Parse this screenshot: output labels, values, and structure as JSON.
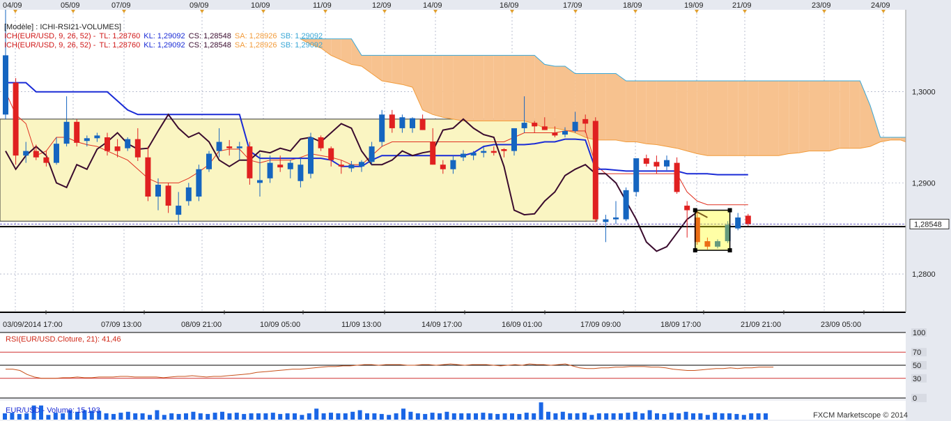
{
  "top_dates": [
    "04/09",
    "05/09",
    "07/09",
    "09/09",
    "10/09",
    "11/09",
    "12/09",
    "14/09",
    "16/09",
    "17/09",
    "18/09",
    "19/09",
    "21/09",
    "23/09",
    "24/09"
  ],
  "bottom_dates": [
    "03/09/2014 17:00",
    "07/09 13:00",
    "08/09 21:00",
    "10/09 05:00",
    "11/09 13:00",
    "14/09 17:00",
    "16/09 01:00",
    "17/09 09:00",
    "18/09 17:00",
    "21/09 21:00",
    "23/09 05:00"
  ],
  "price_axis": {
    "labels": [
      "1,3000",
      "1,2900",
      "1,2800"
    ],
    "values": [
      1.3,
      1.29,
      1.28
    ],
    "current": "1,28548",
    "current_value": 1.28548
  },
  "legend": {
    "line1": {
      "prefix": "[Modèle] : ICHI-RSI21-VOLUMES]"
    },
    "line2": {
      "name": "ICH(EUR/USD, 9, 26, 52) - ",
      "tl": "TL: 1,28760",
      "kl": "KL: 1,29092",
      "cs": "CS: 1,28548",
      "sa": "SA: 1,28926",
      "sb": "SB: 1,29092"
    },
    "line3": {
      "name": "ICH(EUR/USD, 9, 26, 52) - ",
      "tl": "TL: 1,28760",
      "kl": "KL: 1,29092",
      "cs": "CS: 1,28548",
      "sa": "SA: 1,28926",
      "sb": "SB: 1,29092"
    }
  },
  "rsi_panel": {
    "caption": "RSI(EUR/USD.Cloture, 21): 41,46",
    "levels": [
      "100",
      "70",
      "50",
      "30",
      "0"
    ],
    "level_values": [
      100,
      70,
      50,
      30,
      0
    ],
    "current_value": 41.46
  },
  "volume_panel": {
    "caption": "EUR/USD - Volume: 15 193"
  },
  "watermark": "FXCM Marketscope © 2014",
  "colors": {
    "bull": "#1565c0",
    "bear": "#e02020",
    "tenkan": "#e03020",
    "kijun": "#1a2bd6",
    "chikou": "#3a0b2e",
    "cloud_orange": "#f7c28f",
    "cloud_blue": "#a9d4ef",
    "zone": "#faf5c2",
    "grid": "#8a94b0"
  },
  "chart_data": [
    {
      "type": "candlestick",
      "title": "EUR/USD",
      "ylim": [
        1.2758,
        1.309
      ],
      "candles": [
        [
          1.2975,
          1.309,
          1.297,
          1.304
        ],
        [
          1.301,
          1.3015,
          1.292,
          1.293
        ],
        [
          1.293,
          1.2945,
          1.2922,
          1.2935
        ],
        [
          1.2935,
          1.2942,
          1.2925,
          1.2928
        ],
        [
          1.2928,
          1.2935,
          1.2918,
          1.2922
        ],
        [
          1.2922,
          1.295,
          1.292,
          1.2943
        ],
        [
          1.2943,
          1.2995,
          1.294,
          1.2967
        ],
        [
          1.2967,
          1.297,
          1.294,
          1.2944
        ],
        [
          1.2946,
          1.2952,
          1.294,
          1.2949
        ],
        [
          1.2949,
          1.2955,
          1.2945,
          1.2952
        ],
        [
          1.295,
          1.2955,
          1.293,
          1.2935
        ],
        [
          1.294,
          1.2948,
          1.2928,
          1.2935
        ],
        [
          1.2938,
          1.295,
          1.2935,
          1.2948
        ],
        [
          1.2948,
          1.296,
          1.2924,
          1.2928
        ],
        [
          1.2928,
          1.294,
          1.288,
          1.2885
        ],
        [
          1.2885,
          1.2905,
          1.287,
          1.2898
        ],
        [
          1.2897,
          1.29,
          1.2867,
          1.2875
        ],
        [
          1.2865,
          1.289,
          1.2855,
          1.2875
        ],
        [
          1.288,
          1.29,
          1.2875,
          1.2895
        ],
        [
          1.2885,
          1.292,
          1.288,
          1.2915
        ],
        [
          1.2915,
          1.2935,
          1.2912,
          1.2932
        ],
        [
          1.2935,
          1.296,
          1.2928,
          1.2945
        ],
        [
          1.294,
          1.2947,
          1.293,
          1.2938
        ],
        [
          1.2938,
          1.2945,
          1.2925,
          1.294
        ],
        [
          1.294,
          1.2945,
          1.2898,
          1.2905
        ],
        [
          1.29,
          1.2932,
          1.2885,
          1.2903
        ],
        [
          1.2905,
          1.293,
          1.29,
          1.2922
        ],
        [
          1.292,
          1.293,
          1.2912,
          1.2917
        ],
        [
          1.2915,
          1.2925,
          1.2905,
          1.2922
        ],
        [
          1.2902,
          1.2928,
          1.2895,
          1.292
        ],
        [
          1.291,
          1.2955,
          1.2905,
          1.295
        ],
        [
          1.295,
          1.2952,
          1.2935,
          1.2938
        ],
        [
          1.2938,
          1.294,
          1.2918,
          1.2925
        ],
        [
          1.292,
          1.2925,
          1.291,
          1.2918
        ],
        [
          1.2916,
          1.2924,
          1.2912,
          1.292
        ],
        [
          1.2918,
          1.2925,
          1.2912,
          1.2923
        ],
        [
          1.2923,
          1.2945,
          1.292,
          1.294
        ],
        [
          1.2945,
          1.298,
          1.294,
          1.2975
        ],
        [
          1.2975,
          1.298,
          1.2955,
          1.296
        ],
        [
          1.296,
          1.2975,
          1.2955,
          1.2972
        ],
        [
          1.296,
          1.2972,
          1.2955,
          1.2971
        ],
        [
          1.297,
          1.2975,
          1.2958,
          1.2958
        ],
        [
          1.2945,
          1.296,
          1.292,
          1.292
        ],
        [
          1.292,
          1.2925,
          1.291,
          1.2915
        ],
        [
          1.2915,
          1.293,
          1.291,
          1.2925
        ],
        [
          1.2928,
          1.2936,
          1.2924,
          1.2932
        ],
        [
          1.293,
          1.2935,
          1.2925,
          1.2933
        ],
        [
          1.2933,
          1.294,
          1.2928,
          1.2935
        ],
        [
          1.2935,
          1.294,
          1.293,
          1.2933
        ],
        [
          1.2937,
          1.2938,
          1.2928,
          1.2935
        ],
        [
          1.2935,
          1.296,
          1.293,
          1.296
        ],
        [
          1.296,
          1.2995,
          1.2955,
          1.2966
        ],
        [
          1.2966,
          1.2968,
          1.2955,
          1.2962
        ],
        [
          1.2962,
          1.2972,
          1.2958,
          1.2958
        ],
        [
          1.2955,
          1.2962,
          1.295,
          1.2952
        ],
        [
          1.2953,
          1.2961,
          1.295,
          1.2957
        ],
        [
          1.2957,
          1.2978,
          1.2955,
          1.2967
        ],
        [
          1.297,
          1.2975,
          1.2955,
          1.2965
        ],
        [
          1.2968,
          1.2972,
          1.2857,
          1.286
        ],
        [
          1.2857,
          1.2865,
          1.2835,
          1.286
        ],
        [
          1.286,
          1.288,
          1.2855,
          1.2862
        ],
        [
          1.286,
          1.2895,
          1.2858,
          1.2892
        ],
        [
          1.289,
          1.292,
          1.2885,
          1.2927
        ],
        [
          1.2927,
          1.2931,
          1.2918,
          1.2921
        ],
        [
          1.2923,
          1.293,
          1.291,
          1.2918
        ],
        [
          1.2918,
          1.293,
          1.2914,
          1.2925
        ],
        [
          1.2922,
          1.2928,
          1.2888,
          1.289
        ],
        [
          1.2875,
          1.288,
          1.284,
          1.287
        ],
        [
          1.2862,
          1.2868,
          1.2832,
          1.2835
        ],
        [
          1.2836,
          1.284,
          1.2827,
          1.283
        ],
        [
          1.283,
          1.2838,
          1.2828,
          1.2836
        ],
        [
          1.2836,
          1.2858,
          1.2834,
          1.2854
        ],
        [
          1.285,
          1.2867,
          1.2848,
          1.2862
        ],
        [
          1.2864,
          1.2866,
          1.2853,
          1.2855
        ]
      ],
      "tenkan": [
        1.3,
        1.2975,
        1.2965,
        1.293,
        1.2935,
        1.295,
        1.295,
        1.2945,
        1.2942,
        1.294,
        1.2935,
        1.293,
        1.2925,
        1.2915,
        1.2905,
        1.29,
        1.29,
        1.29,
        1.2905,
        1.2912,
        1.292,
        1.2935,
        1.2937,
        1.2937,
        1.2925,
        1.2922,
        1.2925,
        1.2925,
        1.2925,
        1.2928,
        1.2932,
        1.293,
        1.2928,
        1.2925,
        1.292,
        1.292,
        1.293,
        1.294,
        1.2945,
        1.2945,
        1.2945,
        1.2945,
        1.2945,
        1.2945,
        1.2945,
        1.2945,
        1.2945,
        1.2945,
        1.2945,
        1.2945,
        1.295,
        1.2955,
        1.2955,
        1.2955,
        1.2955,
        1.2957,
        1.2957,
        1.2957,
        1.292,
        1.291,
        1.291,
        1.291,
        1.291,
        1.291,
        1.291,
        1.291,
        1.291,
        1.289,
        1.288,
        1.2876,
        1.2876,
        1.2876,
        1.2876,
        1.2876
      ],
      "kijun": [
        1.301,
        1.301,
        1.301,
        1.3,
        1.3,
        1.3,
        1.3,
        1.3,
        1.3,
        1.3,
        1.3,
        1.299,
        1.298,
        1.2975,
        1.2975,
        1.2975,
        1.2975,
        1.2975,
        1.2975,
        1.2975,
        1.2975,
        1.2975,
        1.2975,
        1.2975,
        1.2935,
        1.2927,
        1.2927,
        1.2927,
        1.2927,
        1.2927,
        1.2927,
        1.2927,
        1.2925,
        1.2918,
        1.2918,
        1.2918,
        1.2925,
        1.293,
        1.293,
        1.293,
        1.293,
        1.293,
        1.293,
        1.293,
        1.293,
        1.293,
        1.2933,
        1.294,
        1.2942,
        1.2942,
        1.2942,
        1.2942,
        1.2943,
        1.2945,
        1.2945,
        1.2948,
        1.2948,
        1.2947,
        1.2915,
        1.2915,
        1.2914,
        1.2913,
        1.2913,
        1.2913,
        1.2913,
        1.2913,
        1.2913,
        1.291,
        1.291,
        1.291,
        1.2909,
        1.2909,
        1.2909,
        1.2909
      ],
      "chikou": [
        1.2935,
        1.2915,
        1.293,
        1.294,
        1.293,
        1.29,
        1.2895,
        1.292,
        1.2915,
        1.2937,
        1.2945,
        1.2955,
        1.2943,
        1.2937,
        1.2938,
        1.2957,
        1.2975,
        1.296,
        1.295,
        1.2955,
        1.2945,
        1.2925,
        1.2918,
        1.2925,
        1.2925,
        1.2935,
        1.2933,
        1.2938,
        1.2935,
        1.2948,
        1.295,
        1.2945,
        1.2955,
        1.2965,
        1.296,
        1.2935,
        1.292,
        1.292,
        1.2925,
        1.2935,
        1.293,
        1.2933,
        1.2935,
        1.2958,
        1.296,
        1.297,
        1.296,
        1.2953,
        1.295,
        1.2918,
        1.287,
        1.2865,
        1.2866,
        1.288,
        1.289,
        1.2908,
        1.2915,
        1.292,
        1.291,
        1.291,
        1.29,
        1.288,
        1.286,
        1.2835,
        1.2825,
        1.283,
        1.2845,
        1.286,
        1.2868,
        1.2862
      ],
      "senkou_a": [
        1.3058,
        1.3052,
        1.3048,
        1.304,
        1.3035,
        1.303,
        1.3028,
        1.302,
        1.3012,
        1.301,
        1.3008,
        1.3005,
        1.298,
        1.2975,
        1.2972,
        1.297,
        1.2968,
        1.2968,
        1.2968,
        1.2968,
        1.2968,
        1.2968,
        1.2968,
        1.2965,
        1.296,
        1.296,
        1.2958,
        1.2955,
        1.295,
        1.2947,
        1.2947,
        1.2947,
        1.2945,
        1.2945,
        1.2943,
        1.2942,
        1.294,
        1.2938,
        1.2935,
        1.2932,
        1.293,
        1.293,
        1.293,
        1.293,
        1.293,
        1.293,
        1.293,
        1.293,
        1.2932,
        1.2933,
        1.2935,
        1.2935,
        1.2935,
        1.2938,
        1.2938,
        1.2938,
        1.294,
        1.2945,
        1.2947,
        1.2947,
        1.2943,
        1.2937,
        1.2922,
        1.2916,
        1.2912,
        1.291,
        1.291
      ],
      "senkou_b": [
        1.3058,
        1.3058,
        1.3058,
        1.3058,
        1.3058,
        1.3058,
        1.304,
        1.304,
        1.304,
        1.304,
        1.304,
        1.304,
        1.304,
        1.304,
        1.304,
        1.304,
        1.304,
        1.304,
        1.304,
        1.304,
        1.304,
        1.304,
        1.304,
        1.304,
        1.303,
        1.3028,
        1.3028,
        1.302,
        1.302,
        1.302,
        1.302,
        1.302,
        1.3012,
        1.3012,
        1.3012,
        1.3012,
        1.3012,
        1.3012,
        1.3012,
        1.3012,
        1.3012,
        1.3012,
        1.3012,
        1.3012,
        1.3012,
        1.3012,
        1.3012,
        1.3012,
        1.3012,
        1.3012,
        1.3012,
        1.3012,
        1.3012,
        1.3012,
        1.3012,
        1.3012,
        1.2985,
        1.295,
        1.295,
        1.295,
        1.295,
        1.295,
        1.295,
        1.295,
        1.295,
        1.295,
        1.295,
        1.295,
        1.295,
        1.292,
        1.2913,
        1.2913,
        1.2913,
        1.291
      ],
      "zone": {
        "top": 1.297,
        "bottom": 1.2858,
        "x_end_index": 58
      },
      "hlines": [
        1.2852,
        1.2758
      ]
    },
    {
      "type": "line",
      "title": "RSI(EUR/USD.Cloture, 21)",
      "ylim": [
        0,
        100
      ],
      "levels": [
        100,
        70,
        50,
        30,
        0
      ],
      "values": [
        44,
        44,
        42,
        36,
        32,
        30,
        30,
        30,
        31,
        31,
        32,
        31,
        31,
        32,
        32,
        32,
        33,
        33,
        32,
        32,
        32,
        32,
        31,
        32,
        33,
        33,
        34,
        33,
        32,
        33,
        33,
        34,
        35,
        36,
        37,
        39,
        40,
        41,
        42,
        43,
        44,
        44,
        45,
        46,
        47,
        48,
        48,
        49,
        49,
        50,
        51,
        51,
        50,
        51,
        51,
        51,
        50,
        50,
        51,
        51,
        50,
        51,
        52,
        51,
        50,
        51,
        51,
        51,
        50,
        49,
        50,
        51,
        50,
        52,
        51,
        51,
        50,
        51,
        52,
        49,
        46,
        45,
        45,
        46,
        46,
        47,
        47,
        48,
        48,
        48,
        47,
        47,
        46,
        44,
        43,
        42,
        42,
        43,
        44,
        45,
        45,
        46,
        45,
        46,
        46,
        47,
        47,
        47
      ]
    },
    {
      "type": "bar",
      "title": "EUR/USD - Volume",
      "values": [
        20,
        22,
        18,
        20,
        45,
        45,
        15,
        22,
        20,
        30,
        25,
        30,
        28,
        28,
        20,
        18,
        22,
        25,
        20,
        20,
        15,
        30,
        15,
        20,
        18,
        20,
        25,
        20,
        18,
        22,
        25,
        20,
        22,
        18,
        20,
        20,
        20,
        22,
        18,
        20,
        20,
        15,
        20,
        35,
        20,
        22,
        20,
        20,
        25,
        30,
        20,
        20,
        18,
        15,
        20,
        35,
        25,
        20,
        18,
        22,
        20,
        25,
        20,
        20,
        20,
        20,
        22,
        20,
        18,
        20,
        20,
        18,
        22,
        20,
        55,
        25,
        20,
        25,
        20,
        20,
        22,
        15,
        20,
        20,
        20,
        20,
        22,
        25,
        20,
        30,
        20,
        18,
        22,
        20,
        25,
        20,
        20,
        15,
        22,
        20,
        20,
        18,
        15,
        20,
        20,
        20
      ]
    }
  ]
}
